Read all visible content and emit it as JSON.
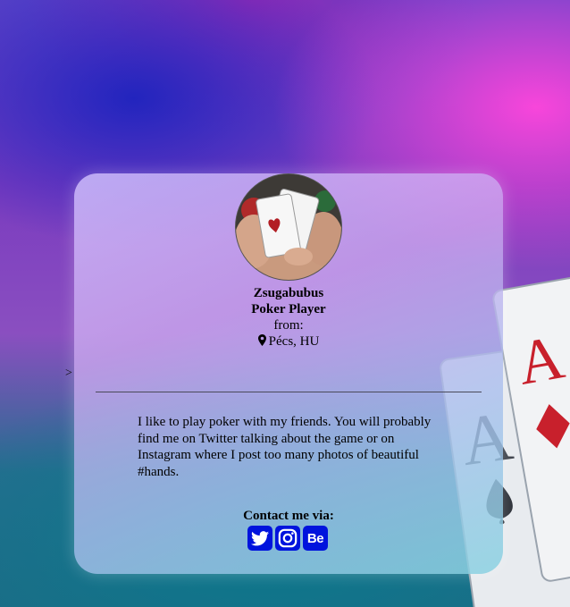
{
  "overlay": {
    "stray_char": ">"
  },
  "profile": {
    "avatar_icon": "poker-hand-aces-photo",
    "name": "Zsugabubus",
    "role": "Poker Player",
    "from_label": "from:",
    "location": "Pécs, HU",
    "location_icon": "map-pin-icon"
  },
  "bio": {
    "text": "I like to play poker with my friends. You will probably find me on Twitter talking about the game or on Instagram where I post too many photos of beautiful #hands."
  },
  "contact": {
    "heading": "Contact me via:",
    "links": [
      {
        "network": "twitter",
        "icon": "twitter-icon"
      },
      {
        "network": "instagram",
        "icon": "instagram-icon"
      },
      {
        "network": "behance",
        "icon": "behance-icon",
        "label": "Be"
      }
    ]
  },
  "colors": {
    "social_button": "#0013dd",
    "card_red": "#c8202c"
  }
}
